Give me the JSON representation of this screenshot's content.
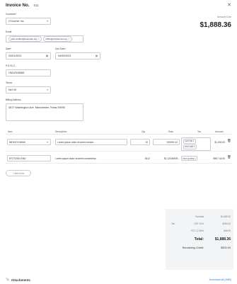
{
  "header": {
    "title": "Invoice No.",
    "number": "011",
    "close_icon": "close-icon"
  },
  "form": {
    "customer_label": "Customer",
    "customer_value": "O'Conner Inc",
    "email_label": "Email",
    "emails": [
      "jack.soulher@example.org",
      "office@myinternet.org"
    ],
    "date_label": "Date",
    "date_value": "03/01/2021",
    "due_label": "Due Date",
    "due_value": "04/09/2021",
    "po_label": "P.O./S.O.",
    "po_value": "OM12345665",
    "terms_label": "Terms",
    "terms_value": "Net 30",
    "billing_label": "Billing Address",
    "billing_value": "4517 Washington Ave. Manchester, Texas 39495"
  },
  "amount_due": {
    "label": "Amount Due",
    "value": "$1,888.36"
  },
  "items": {
    "headers": {
      "item": "Item",
      "description": "Description",
      "qty": "Qty",
      "rate": "Rate",
      "tax": "Tax",
      "amount": "Amount"
    },
    "rows": [
      {
        "item": "INDIGO3-MAIN",
        "description": "Lorem ipsum dolor sit amet consec...",
        "qty": "10",
        "rate": "100000.12",
        "taxes": [
          "GST 6% ×",
          "PST 12% ×"
        ],
        "amount": "$1,000.00"
      },
      {
        "item": "EFZT2082-END",
        "description": "Lorem ipsum dolor sit amet consectetur.",
        "qty": "8112",
        "rate": "$1,12345678...",
        "taxes": [
          "PST 12.25% ×"
        ],
        "amount": "$907.42.00"
      }
    ],
    "add_label": "+ Add a line"
  },
  "totals": {
    "subtotal_label": "Subtotal",
    "subtotal_value": "$1,589.32",
    "tax_label": "Tax",
    "gst_label": "GST 10%",
    "gst_value": "$250.00",
    "pst_label": "PST 12.55%",
    "pst_value": "$48.99",
    "total_label": "Total:",
    "total_value": "$1,888.36",
    "remaining_label": "Remaining Credit:",
    "remaining_value": "$500.00"
  },
  "attachments": {
    "title": "Attachments",
    "download_label": "Download all (1MB)"
  }
}
